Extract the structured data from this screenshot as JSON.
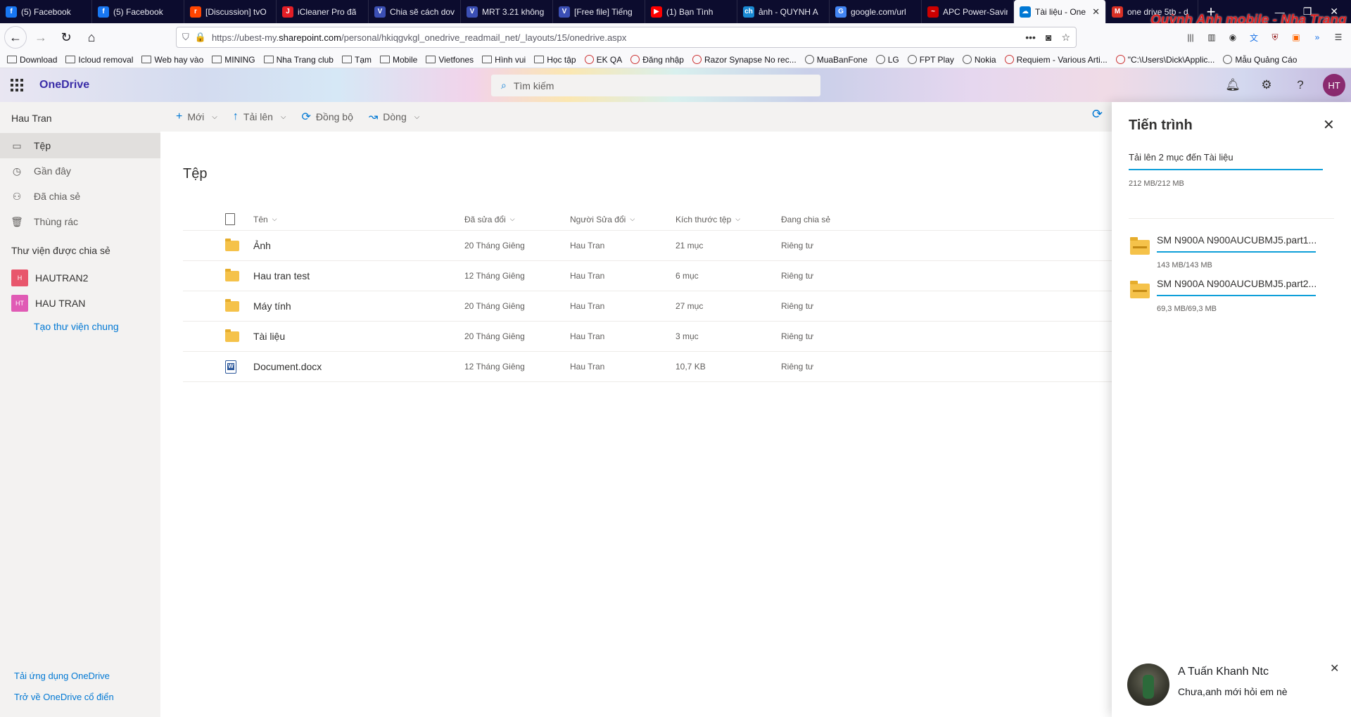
{
  "browser": {
    "tabs": [
      {
        "title": "(5) Facebook",
        "fav": "f",
        "color": "#1877f2"
      },
      {
        "title": "(5) Facebook",
        "fav": "f",
        "color": "#1877f2"
      },
      {
        "title": "[Discussion] tvO",
        "fav": "r",
        "color": "#ff4500"
      },
      {
        "title": "iCleaner Pro đã",
        "fav": "J",
        "color": "#e41e26"
      },
      {
        "title": "Chia sẽ cách dov",
        "fav": "V",
        "color": "#3b4fb4"
      },
      {
        "title": "MRT 3.21 không",
        "fav": "V",
        "color": "#3b4fb4"
      },
      {
        "title": "[Free file] Tiếng",
        "fav": "V",
        "color": "#3b4fb4"
      },
      {
        "title": "(1) Bạn Tình",
        "fav": "▶",
        "color": "#ff0000"
      },
      {
        "title": "ảnh - QUYNH A",
        "fav": "ch",
        "color": "#1a8ad4"
      },
      {
        "title": "google.com/url",
        "fav": "G",
        "color": "#4285f4"
      },
      {
        "title": "APC Power-Savin",
        "fav": "~",
        "color": "#cc0000"
      },
      {
        "title": "Tài liệu - One",
        "fav": "☁",
        "color": "#0078d4",
        "active": true
      },
      {
        "title": "one drive 5tb - d",
        "fav": "M",
        "color": "#d93025"
      }
    ],
    "watermark": "Quỳnh Anh mobile - Nha Trang",
    "url_prefix": "https://ubest-my.",
    "url_domain": "sharepoint.com",
    "url_suffix": "/personal/hkiqgvkgl_onedrive_readmail_net/_layouts/15/onedrive.aspx",
    "bookmarks": [
      {
        "label": "Download",
        "type": "folder"
      },
      {
        "label": "Icloud removal",
        "type": "folder"
      },
      {
        "label": "Web hay vào",
        "type": "folder"
      },
      {
        "label": "MINING",
        "type": "folder"
      },
      {
        "label": "Nha Trang club",
        "type": "folder"
      },
      {
        "label": "Tạm",
        "type": "folder"
      },
      {
        "label": "Mobile",
        "type": "folder"
      },
      {
        "label": "Vietfones",
        "type": "folder"
      },
      {
        "label": "Hình vui",
        "type": "folder"
      },
      {
        "label": "Học tập",
        "type": "folder"
      },
      {
        "label": "EK QA",
        "type": "site"
      },
      {
        "label": "Đăng nhập",
        "type": "site"
      },
      {
        "label": "Razor Synapse No rec...",
        "type": "site"
      },
      {
        "label": "MuaBanFone",
        "type": "globe"
      },
      {
        "label": "LG",
        "type": "globe"
      },
      {
        "label": "FPT Play",
        "type": "globe"
      },
      {
        "label": "Nokia",
        "type": "globe"
      },
      {
        "label": "Requiem - Various Arti...",
        "type": "site"
      },
      {
        "label": "\"C:\\Users\\Dick\\Applic...",
        "type": "site"
      },
      {
        "label": "Mẫu Quảng Cáo",
        "type": "globe"
      }
    ]
  },
  "onedrive": {
    "brand": "OneDrive",
    "search_placeholder": "Tìm kiếm",
    "avatar_initials": "HT",
    "accent": "#0078d4"
  },
  "sidebar": {
    "user": "Hau Tran",
    "items": [
      {
        "label": "Tệp",
        "icon": "folder-icon",
        "glyph": "▭",
        "active": true
      },
      {
        "label": "Gần đây",
        "icon": "clock-icon",
        "glyph": "◷"
      },
      {
        "label": "Đã chia sẻ",
        "icon": "people-icon",
        "glyph": "⚇"
      },
      {
        "label": "Thùng rác",
        "icon": "trash-icon",
        "glyph": "🗑"
      }
    ],
    "libraries_title": "Thư viện được chia sẻ",
    "libraries": [
      {
        "label": "HAUTRAN2",
        "badge": "H",
        "color": "#e8566c"
      },
      {
        "label": "HAU TRAN",
        "badge": "HT",
        "color": "#e05bb5"
      }
    ],
    "create_library": "Tạo thư viện chung",
    "get_app": "Tải ứng dụng OneDrive",
    "classic": "Trở về OneDrive cổ điển"
  },
  "commands": [
    {
      "label": "Mới",
      "glyph": "+",
      "name": "new"
    },
    {
      "label": "Tải lên",
      "glyph": "↑",
      "name": "upload"
    },
    {
      "label": "Đồng bộ",
      "glyph": "⟳",
      "name": "sync"
    },
    {
      "label": "Dòng",
      "glyph": "↝",
      "name": "flow"
    }
  ],
  "main": {
    "title": "Tệp",
    "columns": {
      "name": "Tên",
      "modified": "Đã sửa đổi",
      "modified_by": "Người Sửa đổi",
      "size": "Kích thước tệp",
      "sharing": "Đang chia sẻ"
    },
    "rows": [
      {
        "name": "Ảnh",
        "type": "folder",
        "modified": "20 Tháng Giêng",
        "by": "Hau Tran",
        "size": "21 mục",
        "sharing": "Riêng tư"
      },
      {
        "name": "Hau tran test",
        "type": "folder",
        "modified": "12 Tháng Giêng",
        "by": "Hau Tran",
        "size": "6 mục",
        "sharing": "Riêng tư"
      },
      {
        "name": "Máy tính",
        "type": "folder",
        "modified": "20 Tháng Giêng",
        "by": "Hau Tran",
        "size": "27 mục",
        "sharing": "Riêng tư"
      },
      {
        "name": "Tài liệu",
        "type": "folder",
        "modified": "20 Tháng Giêng",
        "by": "Hau Tran",
        "size": "3 mục",
        "sharing": "Riêng tư"
      },
      {
        "name": "Document.docx",
        "type": "docx",
        "modified": "12 Tháng Giêng",
        "by": "Hau Tran",
        "size": "10,7 KB",
        "sharing": "Riêng tư"
      }
    ]
  },
  "progress": {
    "title": "Tiến trình",
    "summary": "Tải lên 2 mục đến Tài liệu",
    "summary_size": "212 MB/212 MB",
    "summary_fraction": 1.0,
    "items": [
      {
        "name": "SM N900A N900AUCUBMJ5.part1...",
        "size": "143 MB/143 MB",
        "fraction": 1.0
      },
      {
        "name": "SM N900A N900AUCUBMJ5.part2...",
        "size": "69,3 MB/69,3 MB",
        "fraction": 1.0
      }
    ]
  },
  "chat": {
    "name": "A Tuấn Khanh Ntc",
    "message": "Chưa,anh mới hỏi em nè"
  }
}
